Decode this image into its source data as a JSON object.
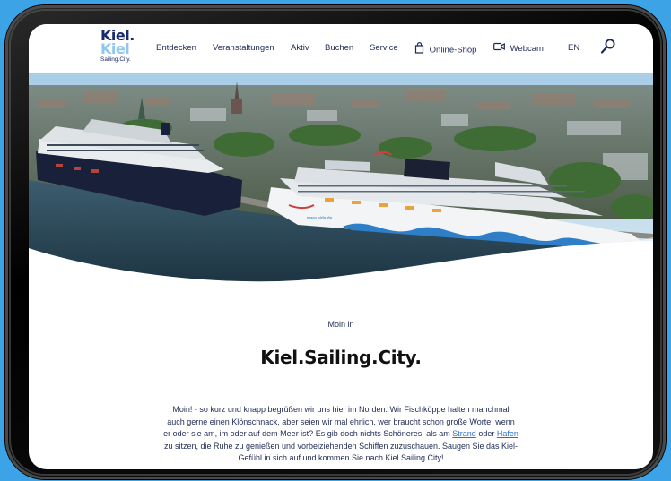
{
  "logo": {
    "line1": "Kiel.",
    "line2": "Kiel",
    "tagline": "Sailing.City."
  },
  "nav": {
    "items": [
      {
        "label": "Entdecken"
      },
      {
        "label": "Veranstaltungen"
      },
      {
        "label": "Aktiv"
      },
      {
        "label": "Buchen"
      },
      {
        "label": "Service"
      },
      {
        "label": "Online-Shop",
        "icon": "shopping-bag-icon"
      },
      {
        "label": "Webcam",
        "icon": "camera-icon"
      },
      {
        "label": "EN"
      }
    ],
    "search_icon": "search-icon"
  },
  "hero": {
    "ship_hull_text": "www.aida.de"
  },
  "content": {
    "kicker": "Moin in",
    "headline": "Kiel.Sailing.City.",
    "intro_part1": "Moin! - so kurz und knapp begrüßen wir uns hier im Norden. Wir Fischköppe halten manchmal auch gerne einen Klönschnack, aber seien wir mal ehrlich, wer braucht schon große Worte, wenn er oder sie am, im oder auf dem Meer ist? Es gib doch nichts Schöneres, als am ",
    "link_strand": "Strand",
    "intro_part2": " oder ",
    "link_hafen": "Hafen",
    "intro_part3": " zu sitzen, die Ruhe zu genießen und vorbeiziehenden Schiffen zuzuschauen. Saugen Sie das Kiel-Gefühl in sich auf und kommen Sie nach Kiel.Sailing.City!"
  },
  "colors": {
    "background": "#3ba3e6",
    "brand_dark": "#1b2a6b",
    "brand_light": "#8fc7ee",
    "link": "#2a6fcf"
  }
}
